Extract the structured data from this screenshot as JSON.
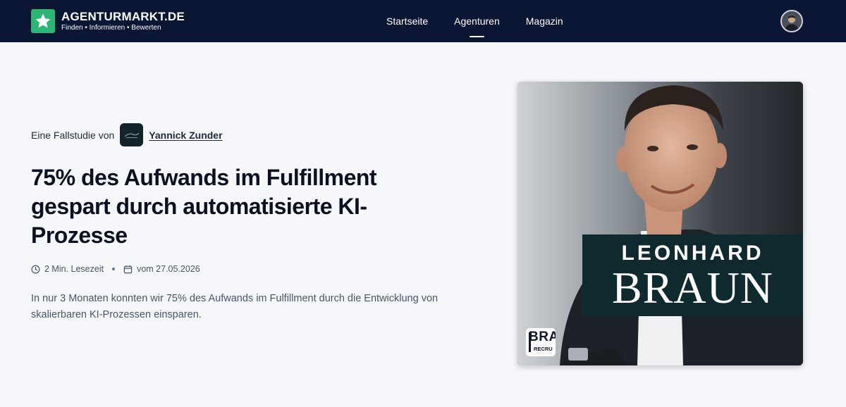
{
  "brand": {
    "name": "AGENTURMARKT.DE",
    "tagline": "Finden • Informieren • Bewerten",
    "icon": "star-icon",
    "color": "#2bb673"
  },
  "nav": {
    "items": [
      {
        "label": "Startseite",
        "active": false
      },
      {
        "label": "Agenturen",
        "active": true
      },
      {
        "label": "Magazin",
        "active": false
      }
    ],
    "background": "#0b1534"
  },
  "user": {
    "avatar": "user-avatar"
  },
  "case_study": {
    "prefix": "Eine Fallstudie von",
    "agency_name": "Yannick Zunder",
    "title": "75% des Aufwands im Fulfillment gespart durch automatisierte KI-Prozesse",
    "reading_time": "2 Min. Lesezeit",
    "date": "vom 27.05.2026",
    "summary": "In nur 3 Monaten konnten wir 75% des Aufwands im Fulfillment durch die Entwicklung von skalierbaren KI-Prozessen einsparen."
  },
  "hero_image": {
    "first_name": "LEONHARD",
    "last_name": "BRAUN",
    "badge_top": "BRA",
    "badge_sub": "RECRU"
  }
}
